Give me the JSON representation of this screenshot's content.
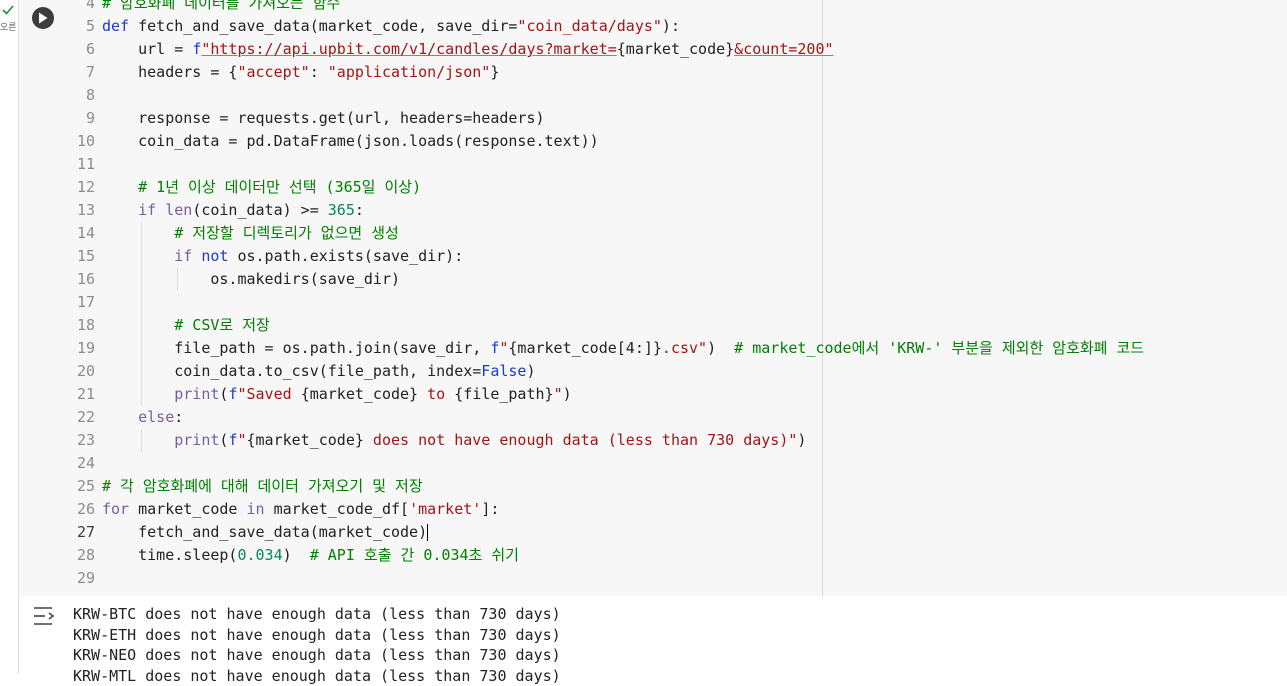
{
  "cell_status": {
    "label": "오른"
  },
  "code_lines": [
    {
      "num": "4",
      "segments": [
        {
          "cls": "cm",
          "text": "# 암호화폐 데이터를 가져오는 함수"
        }
      ]
    },
    {
      "num": "5",
      "segments": [
        {
          "cls": "kw",
          "text": "def"
        },
        {
          "cls": "",
          "text": " fetch_and_save_data(market_code, save_dir="
        },
        {
          "cls": "str",
          "text": "\"coin_data/days\""
        },
        {
          "cls": "",
          "text": "):"
        }
      ]
    },
    {
      "num": "6",
      "segments": [
        {
          "cls": "",
          "text": "    url = "
        },
        {
          "cls": "kw",
          "text": "f"
        },
        {
          "cls": "url",
          "text": "\"https://api.upbit.com/v1/candles/days?market="
        },
        {
          "cls": "",
          "text": "{market_code}"
        },
        {
          "cls": "url",
          "text": "&count=200\""
        }
      ]
    },
    {
      "num": "7",
      "segments": [
        {
          "cls": "",
          "text": "    headers = {"
        },
        {
          "cls": "str",
          "text": "\"accept\""
        },
        {
          "cls": "",
          "text": ": "
        },
        {
          "cls": "str",
          "text": "\"application/json\""
        },
        {
          "cls": "",
          "text": "}"
        }
      ]
    },
    {
      "num": "8",
      "segments": []
    },
    {
      "num": "9",
      "segments": [
        {
          "cls": "",
          "text": "    response = requests.get(url, headers=headers)"
        }
      ]
    },
    {
      "num": "10",
      "segments": [
        {
          "cls": "",
          "text": "    coin_data = pd.DataFrame(json.loads(response.text))"
        }
      ]
    },
    {
      "num": "11",
      "segments": []
    },
    {
      "num": "12",
      "segments": [
        {
          "cls": "cm",
          "text": "    # 1년 이상 데이터만 선택 (365일 이상)"
        }
      ]
    },
    {
      "num": "13",
      "segments": [
        {
          "cls": "",
          "text": "    "
        },
        {
          "cls": "kw2",
          "text": "if"
        },
        {
          "cls": "",
          "text": " "
        },
        {
          "cls": "kw2",
          "text": "len"
        },
        {
          "cls": "",
          "text": "(coin_data) >= "
        },
        {
          "cls": "num",
          "text": "365"
        },
        {
          "cls": "",
          "text": ":"
        }
      ]
    },
    {
      "num": "14",
      "segments": [
        {
          "cls": "cm",
          "text": "        # 저장할 디렉토리가 없으면 생성"
        }
      ]
    },
    {
      "num": "15",
      "segments": [
        {
          "cls": "",
          "text": "        "
        },
        {
          "cls": "kw2",
          "text": "if"
        },
        {
          "cls": "",
          "text": " "
        },
        {
          "cls": "kw",
          "text": "not"
        },
        {
          "cls": "",
          "text": " os.path.exists(save_dir):"
        }
      ]
    },
    {
      "num": "16",
      "segments": [
        {
          "cls": "",
          "text": "            os.makedirs(save_dir)"
        }
      ]
    },
    {
      "num": "17",
      "segments": []
    },
    {
      "num": "18",
      "segments": [
        {
          "cls": "cm",
          "text": "        # CSV로 저장"
        }
      ]
    },
    {
      "num": "19",
      "segments": [
        {
          "cls": "",
          "text": "        file_path = os.path.join(save_dir, "
        },
        {
          "cls": "kw",
          "text": "f"
        },
        {
          "cls": "str",
          "text": "\""
        },
        {
          "cls": "",
          "text": "{market_code[4:]}"
        },
        {
          "cls": "str",
          "text": ".csv\""
        },
        {
          "cls": "",
          "text": ")  "
        },
        {
          "cls": "cm",
          "text": "# market_code에서 'KRW-' 부분을 제외한 암호화폐 코드"
        }
      ]
    },
    {
      "num": "20",
      "segments": [
        {
          "cls": "",
          "text": "        coin_data.to_csv(file_path, index="
        },
        {
          "cls": "kw",
          "text": "False"
        },
        {
          "cls": "",
          "text": ")"
        }
      ]
    },
    {
      "num": "21",
      "segments": [
        {
          "cls": "",
          "text": "        "
        },
        {
          "cls": "kw2",
          "text": "print"
        },
        {
          "cls": "",
          "text": "("
        },
        {
          "cls": "kw",
          "text": "f"
        },
        {
          "cls": "str",
          "text": "\"Saved "
        },
        {
          "cls": "",
          "text": "{market_code}"
        },
        {
          "cls": "str",
          "text": " to "
        },
        {
          "cls": "",
          "text": "{file_path}"
        },
        {
          "cls": "str",
          "text": "\""
        },
        {
          "cls": "",
          "text": ")"
        }
      ]
    },
    {
      "num": "22",
      "segments": [
        {
          "cls": "",
          "text": "    "
        },
        {
          "cls": "kw2",
          "text": "else"
        },
        {
          "cls": "",
          "text": ":"
        }
      ]
    },
    {
      "num": "23",
      "segments": [
        {
          "cls": "",
          "text": "        "
        },
        {
          "cls": "kw2",
          "text": "print"
        },
        {
          "cls": "",
          "text": "("
        },
        {
          "cls": "kw",
          "text": "f"
        },
        {
          "cls": "str",
          "text": "\""
        },
        {
          "cls": "",
          "text": "{market_code}"
        },
        {
          "cls": "str",
          "text": " does not have enough data (less than 730 days)\""
        },
        {
          "cls": "",
          "text": ")"
        }
      ]
    },
    {
      "num": "24",
      "segments": []
    },
    {
      "num": "25",
      "segments": [
        {
          "cls": "cm",
          "text": "# 각 암호화폐에 대해 데이터 가져오기 및 저장"
        }
      ]
    },
    {
      "num": "26",
      "segments": [
        {
          "cls": "kw2",
          "text": "for"
        },
        {
          "cls": "",
          "text": " market_code "
        },
        {
          "cls": "kw2",
          "text": "in"
        },
        {
          "cls": "",
          "text": " market_code_df["
        },
        {
          "cls": "str",
          "text": "'market'"
        },
        {
          "cls": "",
          "text": "]:"
        }
      ]
    },
    {
      "num": "27",
      "segments": [
        {
          "cls": "",
          "text": "    fetch_and_save_data(market_code)"
        }
      ]
    },
    {
      "num": "28",
      "segments": [
        {
          "cls": "",
          "text": "    time.sleep("
        },
        {
          "cls": "num",
          "text": "0.034"
        },
        {
          "cls": "",
          "text": ")  "
        },
        {
          "cls": "cm",
          "text": "# API 호출 간 0.034초 쉬기"
        }
      ]
    },
    {
      "num": "29",
      "segments": []
    }
  ],
  "output_lines": [
    "KRW-BTC does not have enough data (less than 730 days)",
    "KRW-ETH does not have enough data (less than 730 days)",
    "KRW-NEO does not have enough data (less than 730 days)",
    "KRW-MTL does not have enough data (less than 730 days)"
  ],
  "colors": {
    "keyword": "#1a3bd1",
    "string": "#a31515",
    "comment": "#008000",
    "number": "#098658"
  },
  "icons": {
    "run": "play-icon",
    "output": "output-toggle-icon",
    "status": "check-icon"
  }
}
